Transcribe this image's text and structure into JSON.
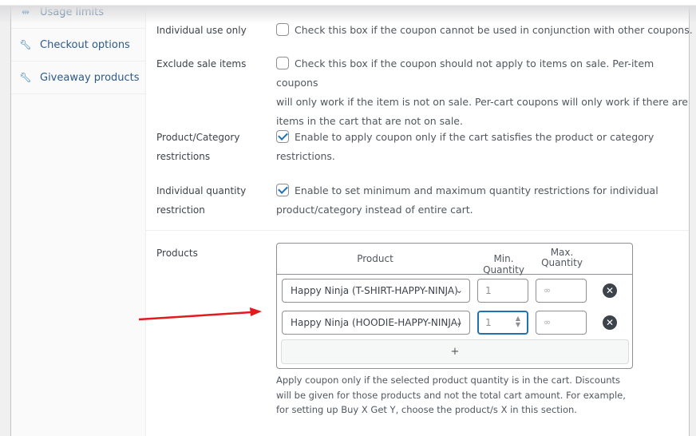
{
  "sidebar": {
    "items": [
      {
        "label": "Usage limits",
        "icon": "usage-limits-icon"
      },
      {
        "label": "Checkout options",
        "icon": "wrench-icon"
      },
      {
        "label": "Giveaway products",
        "icon": "wrench-icon"
      }
    ]
  },
  "settings": {
    "individual_use": {
      "label": "Individual use only",
      "checked": false,
      "text": "Check this box if the coupon cannot be used in conjunction with other coupons."
    },
    "exclude_sale": {
      "label": "Exclude sale items",
      "checked": false,
      "text": "Check this box if the coupon should not apply to items on sale. Per-item coupons",
      "text2": "will only work if the item is not on sale. Per-cart coupons will only work if there are",
      "text3": "items in the cart that are not on sale."
    },
    "product_category": {
      "label1": "Product/Category",
      "label2": "restrictions",
      "checked": true,
      "text": "Enable to apply coupon only if the cart satisfies the product or category",
      "text2": "restrictions."
    },
    "individual_quantity": {
      "label1": "Individual quantity",
      "label2": "restriction",
      "checked": true,
      "text": "Enable to set minimum and maximum quantity restrictions for individual",
      "text2": "product/category instead of entire cart."
    }
  },
  "products": {
    "label": "Products",
    "headers": {
      "product": "Product",
      "min": "Min. Quantity",
      "max1": "Max.",
      "max2": "Quantity"
    },
    "rows": [
      {
        "product": "Happy Ninja (T-SHIRT-HAPPY-NINJA)",
        "min": "1",
        "max_placeholder": "∞"
      },
      {
        "product": "Happy Ninja (HOODIE-HAPPY-NINJA)",
        "min": "1",
        "max_placeholder": "∞"
      }
    ],
    "add_label": "+",
    "help": "Apply coupon only if the selected product quantity is in the cart. Discounts will be given for those products and not the total cart amount. For example, for setting up Buy X Get Y, choose the product/s X in this section."
  },
  "colors": {
    "accent": "#2271b1",
    "annotation_arrow": "#e01b1b"
  }
}
